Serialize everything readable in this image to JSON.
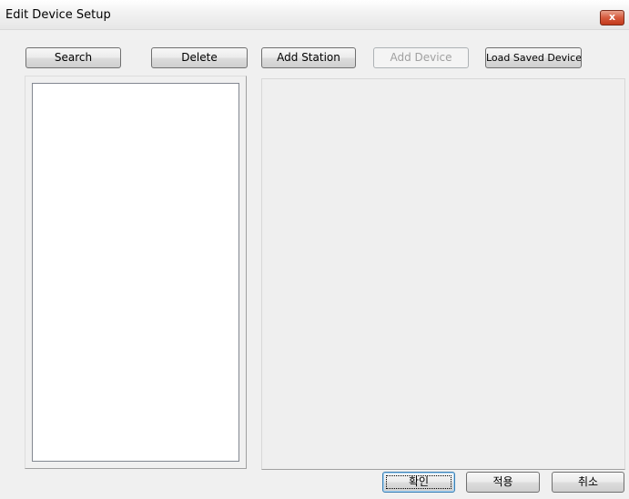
{
  "window": {
    "title": "Edit Device Setup",
    "close_label": "x"
  },
  "toolbar": {
    "search_label": "Search",
    "delete_label": "Delete",
    "add_station_label": "Add Station",
    "add_device_label": "Add Device",
    "load_saved_device_label": "Load Saved Device"
  },
  "footer": {
    "ok_label": "확인",
    "apply_label": "적용",
    "cancel_label": "취소"
  }
}
